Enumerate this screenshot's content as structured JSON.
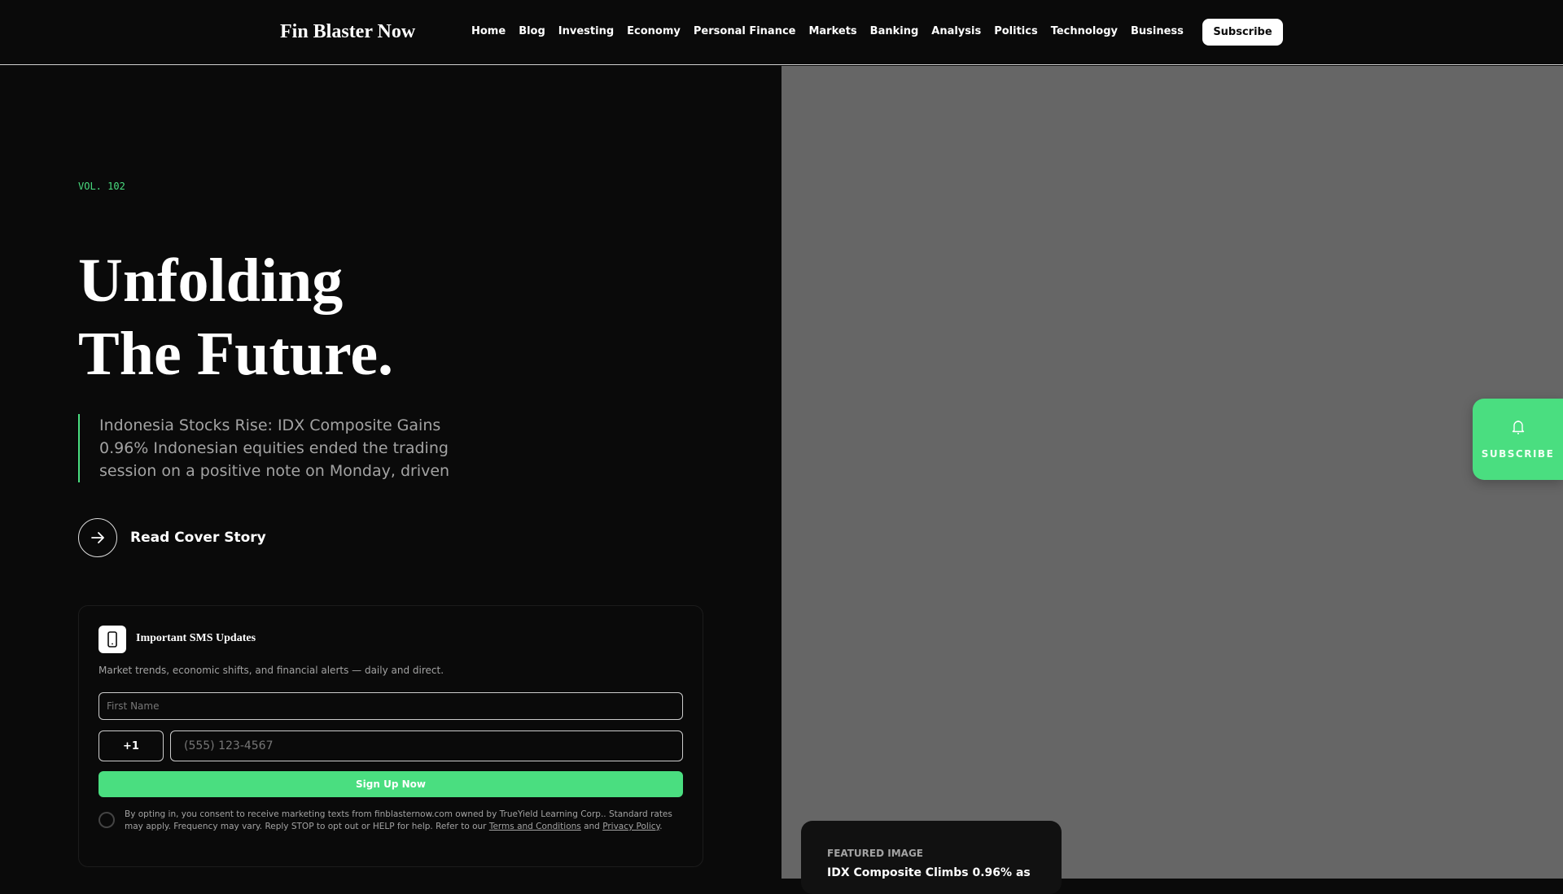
{
  "header": {
    "logo": "Fin Blaster Now",
    "nav": [
      "Home",
      "Blog",
      "Investing",
      "Economy",
      "Personal Finance",
      "Markets",
      "Banking",
      "Analysis",
      "Politics",
      "Technology",
      "Business"
    ],
    "subscribe_label": "Subscribe"
  },
  "hero": {
    "volume": "VOL. 102",
    "title_line1": "Unfolding",
    "title_line2": "The Future.",
    "excerpt": "Indonesia Stocks Rise: IDX Composite Gains 0.96% Indonesian equities ended the trading session on a positive note on Monday, driven",
    "cta_label": "Read Cover Story"
  },
  "sms": {
    "title": "Important SMS Updates",
    "description": "Market trends, economic shifts, and financial alerts — daily and direct.",
    "first_name_placeholder": "First Name",
    "country_code": "+1",
    "phone_placeholder": "(555) 123-4567",
    "submit_label": "Sign Up Now",
    "legal_text": "By opting in, you consent to receive marketing texts from finblasternow.com owned by TrueYield Learning Corp.. Standard rates may apply. Frequency may vary. Reply STOP to opt out or HELP for help. Refer to our ",
    "terms_link": "Terms and Conditions",
    "and": " and ",
    "privacy_link": "Privacy Policy",
    "period": "."
  },
  "floating_subscribe": {
    "label": "SUBSCRIBE",
    "icon": "bell-icon"
  },
  "featured": {
    "label": "FEATURED IMAGE",
    "title": "IDX Composite Climbs 0.96% as"
  },
  "colors": {
    "accent": "#4ade80",
    "background": "#0a0a0a",
    "image_placeholder": "#666666"
  }
}
